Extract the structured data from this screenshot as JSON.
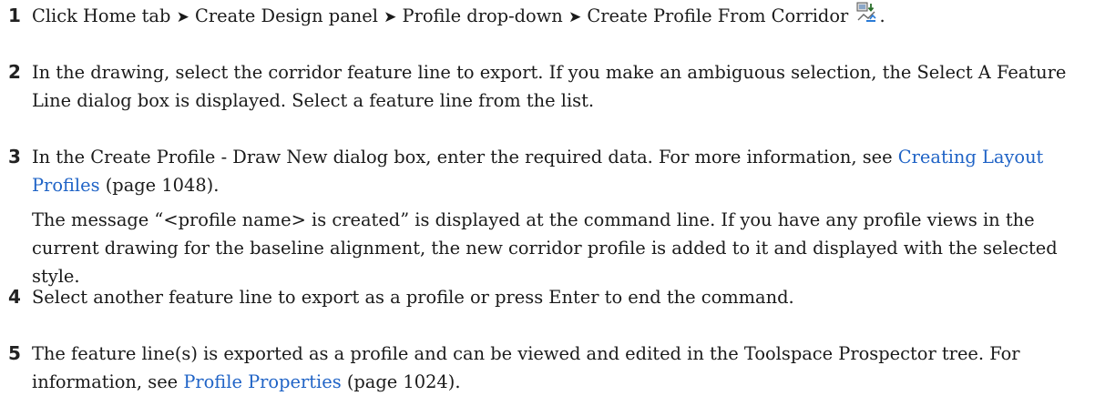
{
  "steps": [
    {
      "number": "1",
      "parts": {
        "a": "Click Home tab",
        "sep": "➤",
        "b": "Create Design panel",
        "c": "Profile drop-down",
        "d": "Create Profile From Corridor",
        "end": "."
      },
      "icon": "create-profile-from-corridor-icon"
    },
    {
      "number": "2",
      "text": "In the drawing, select the corridor feature line to export. If you make an ambiguous selection, the Select A Feature Line dialog box is displayed. Select a feature line from the list."
    },
    {
      "number": "3",
      "pre": "In the Create Profile - Draw New dialog box, enter the required data. For more information, see ",
      "link": "Creating Layout Profiles",
      "post": " (page 1048).",
      "note": "The message “<profile name> is created” is displayed at the command line. If you have any profile views in the current drawing for the baseline alignment, the new corridor profile is added to it and displayed with the selected style."
    },
    {
      "number": "4",
      "text": "Select another feature line to export as a profile or press Enter to end the command."
    },
    {
      "number": "5",
      "pre": "The feature line(s) is exported as a profile and can be viewed and edited in the Toolspace Prospector tree. For information, see ",
      "link": "Profile Properties",
      "post": " (page 1024)."
    }
  ],
  "colors": {
    "link": "#1f63c6",
    "text": "#1a1a1a"
  }
}
